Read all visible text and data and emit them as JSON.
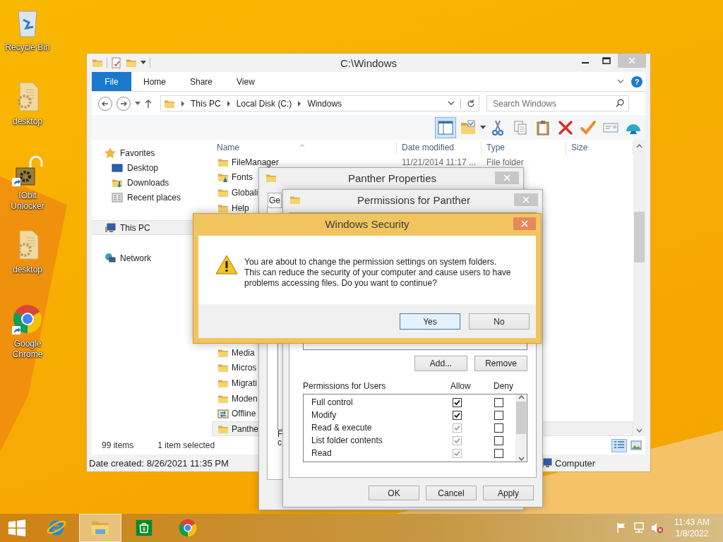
{
  "desktop_icons": [
    {
      "label": "Recycle Bin",
      "kind": "recycle-bin"
    },
    {
      "label": "desktop",
      "kind": "settings-file"
    },
    {
      "label": "IObit Unlocker",
      "kind": "unlocker"
    },
    {
      "label": "desktop",
      "kind": "settings-file"
    },
    {
      "label": "Google Chrome",
      "kind": "chrome"
    }
  ],
  "explorer": {
    "title": "C:\\Windows",
    "ribbon_tabs": [
      {
        "label": "File",
        "kind": "file-menu",
        "selected": false
      },
      {
        "label": "Home",
        "kind": "tab",
        "selected": false
      },
      {
        "label": "Share",
        "kind": "tab",
        "selected": false
      },
      {
        "label": "View",
        "kind": "tab",
        "selected": false
      }
    ],
    "help_glyph": "?",
    "breadcrumb": [
      "This PC",
      "Local Disk (C:)",
      "Windows"
    ],
    "search": {
      "placeholder": "Search Windows"
    },
    "preview_pane": {
      "on": true
    },
    "toolbar": [
      {
        "kind": "folder-check"
      },
      {
        "kind": "cut"
      },
      {
        "kind": "copy"
      },
      {
        "kind": "paste"
      },
      {
        "kind": "delete"
      },
      {
        "kind": "check"
      },
      {
        "kind": "rename"
      },
      {
        "kind": "shell"
      }
    ],
    "nav": [
      {
        "label": "Favorites",
        "kind": "star",
        "selected": false,
        "children": [
          {
            "label": "Desktop",
            "kind": "desktop",
            "selected": false
          },
          {
            "label": "Downloads",
            "kind": "downloads",
            "selected": false
          },
          {
            "label": "Recent places",
            "kind": "recent",
            "selected": false
          }
        ]
      },
      {
        "label": "This PC",
        "kind": "pc",
        "selected": true
      },
      {
        "label": "Network",
        "kind": "network",
        "selected": false
      }
    ],
    "columns": [
      "Name",
      "Date modified",
      "Type",
      "Size"
    ],
    "files": [
      {
        "name": "FileManager",
        "date": "11/21/2014 11:17 ...",
        "type": "File folder",
        "kind": "folder",
        "selected": false
      },
      {
        "name": "Fonts",
        "kind": "fonts",
        "selected": false
      },
      {
        "name": "Globali",
        "kind": "folder",
        "selected": false
      },
      {
        "name": "Help",
        "kind": "folder",
        "selected": false
      },
      {
        "name": "Media",
        "kind": "folder",
        "selected": false
      },
      {
        "name": "Micros",
        "kind": "folder",
        "selected": false
      },
      {
        "name": "Migrati",
        "kind": "folder",
        "selected": false
      },
      {
        "name": "Moden",
        "kind": "folder",
        "selected": false
      },
      {
        "name": "Offline",
        "kind": "offline",
        "selected": false
      },
      {
        "name": "Panthe",
        "kind": "folder",
        "selected": true
      }
    ],
    "status": {
      "count": "99 items",
      "selection": "1 item selected"
    },
    "view_buttons": [
      {
        "kind": "details",
        "selected": true
      },
      {
        "kind": "large-icons",
        "selected": false
      }
    ],
    "details": {
      "created": "Date created: 8/26/2021 11:35 PM",
      "location": "Computer"
    }
  },
  "properties": {
    "title": "Panther Properties",
    "tab": "Ge",
    "fragments": [
      "F",
      "c"
    ]
  },
  "permissions": {
    "title": "Permissions for Panther",
    "list_buttons": [
      "Add...",
      "Remove"
    ],
    "group_label": "Permissions for Users",
    "columns": [
      "Allow",
      "Deny"
    ],
    "entries": [
      {
        "label": "Full control",
        "allow": true,
        "allow_disabled": false,
        "deny": false
      },
      {
        "label": "Modify",
        "allow": true,
        "allow_disabled": false,
        "deny": false
      },
      {
        "label": "Read & execute",
        "allow": true,
        "allow_disabled": true,
        "deny": false
      },
      {
        "label": "List folder contents",
        "allow": true,
        "allow_disabled": true,
        "deny": false
      },
      {
        "label": "Read",
        "allow": true,
        "allow_disabled": true,
        "deny": false
      }
    ],
    "buttons": [
      "OK",
      "Cancel",
      "Apply"
    ]
  },
  "security": {
    "title": "Windows Security",
    "message": "You are about to change the permission settings on system folders.\nThis can reduce the security of your computer and cause users to have\nproblems accessing files. Do you want to continue?",
    "buttons": [
      {
        "label": "Yes",
        "default": true
      },
      {
        "label": "No",
        "default": false
      }
    ]
  },
  "taskbar": {
    "apps": [
      {
        "kind": "start",
        "active": false
      },
      {
        "kind": "browser",
        "active": false
      },
      {
        "kind": "explorer",
        "active": true
      },
      {
        "kind": "store",
        "active": false
      },
      {
        "kind": "chrome",
        "active": false
      }
    ],
    "time": "11:43 AM",
    "date": "1/8/2022"
  }
}
